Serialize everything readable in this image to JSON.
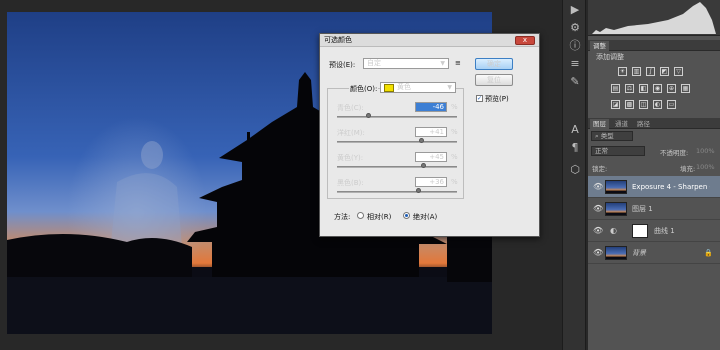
{
  "canvas": {
    "image_alt": "silhouette of pavilion at dusk with ghost figure"
  },
  "toolstrip": {
    "icons": [
      "play-icon",
      "settings-icon",
      "info-icon",
      "adjust-icon",
      "brush-icon",
      "text-icon",
      "paragraph-icon",
      "3d-icon"
    ]
  },
  "panels": {
    "adjust_tab": "调整",
    "add_adjust_label": "添加调整",
    "layers_tabs": [
      "图层",
      "通道",
      "路径"
    ],
    "filter_label": "类型",
    "blend_mode": "正常",
    "opacity_label": "不透明度:",
    "opacity_value": "100%",
    "lock_label": "锁定:",
    "fill_label": "填充:",
    "fill_value": "100%"
  },
  "layers": [
    {
      "name": "Exposure 4 - Sharpen - L...",
      "selected": true
    },
    {
      "name": "图层 1",
      "selected": false
    },
    {
      "name": "曲线 1",
      "selected": false
    },
    {
      "name": "背景",
      "selected": false
    }
  ],
  "dialog": {
    "title": "可选颜色",
    "close_label": "x",
    "preset_label": "预设(E):",
    "preset_value": "自定",
    "colors_label": "颜色(O):",
    "colors_value": "黄色",
    "ok_label": "确定",
    "reset_label": "复位",
    "preview_label": "预览(P)",
    "preview_checked": true,
    "method_label": "方法:",
    "method_relative": "相对(R)",
    "method_absolute": "绝对(A)",
    "method_selected": "absolute",
    "pct_sign": "%",
    "sliders": [
      {
        "label": "青色(C):",
        "value": "-46",
        "level": -46
      },
      {
        "label": "洋红(M):",
        "value": "+41",
        "level": 41
      },
      {
        "label": "黄色(Y):",
        "value": "+45",
        "level": 45
      },
      {
        "label": "黑色(B):",
        "value": "+36",
        "level": 36
      }
    ]
  },
  "colors": {
    "swatch_yellow": "#f2e000",
    "accent": "#3d7fd4"
  }
}
